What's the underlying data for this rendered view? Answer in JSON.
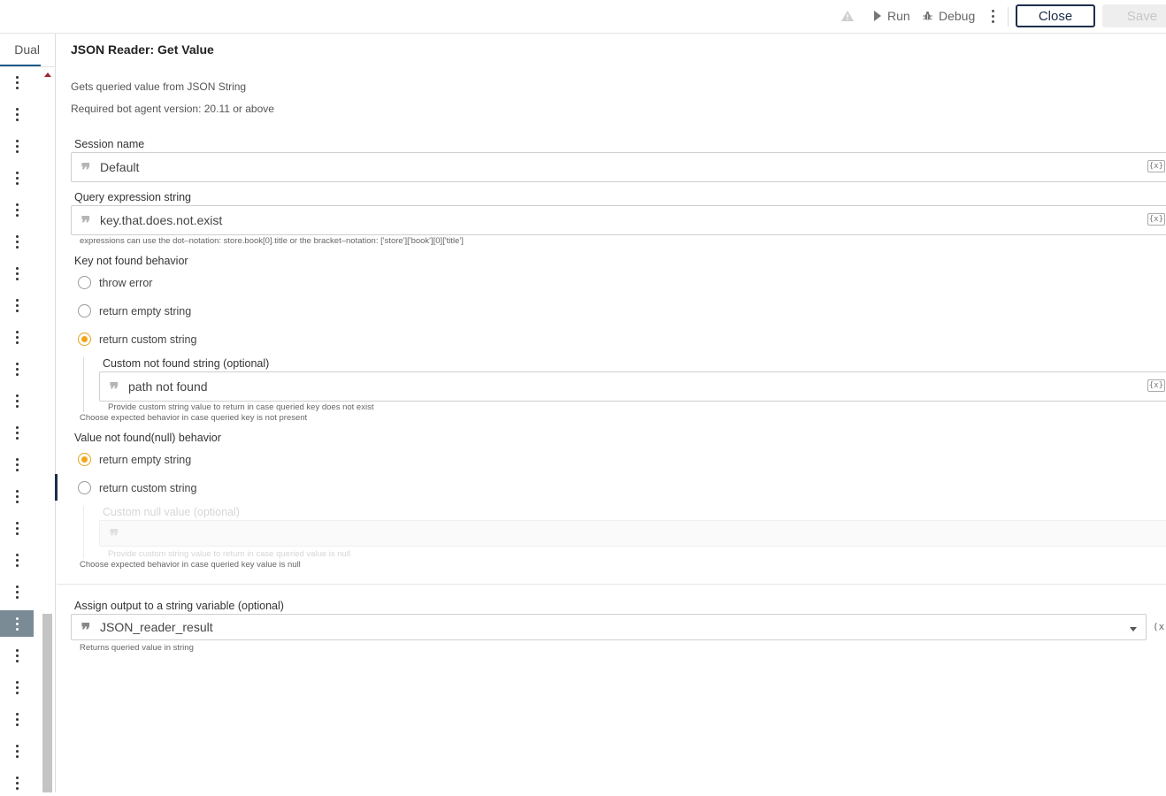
{
  "toolbar": {
    "run_label": "Run",
    "debug_label": "Debug",
    "close_label": "Close",
    "save_label": "Save"
  },
  "left_panel": {
    "tab_label": "Dual",
    "row_count": 23,
    "active_row": 17
  },
  "panel": {
    "title": "JSON Reader: Get Value",
    "description": "Gets queried value from JSON String",
    "version": "Required bot agent version: 20.11 or above"
  },
  "session": {
    "label": "Session name",
    "value": "Default"
  },
  "query": {
    "label": "Query expression string",
    "value": "key.that.does.not.exist",
    "hint": "expressions can use the dot–notation: store.book[0].title or the bracket–notation: ['store']['book'][0]['title']"
  },
  "key_not_found": {
    "label": "Key not found behavior",
    "options": [
      "throw error",
      "return empty string",
      "return custom string"
    ],
    "selected": 2,
    "custom_label": "Custom not found string (optional)",
    "custom_value": "path not found",
    "custom_hint": "Provide custom string value to return in case queried key does not exist",
    "hint": "Choose expected behavior in case queried key is not present"
  },
  "value_not_found": {
    "label": "Value not found(null) behavior",
    "options": [
      "return empty string",
      "return custom string"
    ],
    "selected": 0,
    "custom_label": "Custom null value (optional)",
    "custom_value": "",
    "custom_hint": "Provide custom string value to return in case queried value is null",
    "hint": "Choose expected behavior in case queried key value is null"
  },
  "output": {
    "label": "Assign output to a string variable (optional)",
    "value": "JSON_reader_result",
    "hint": "Returns queried value in string"
  },
  "icons": {
    "var_insert": "{x}",
    "var_output": "(x)"
  }
}
